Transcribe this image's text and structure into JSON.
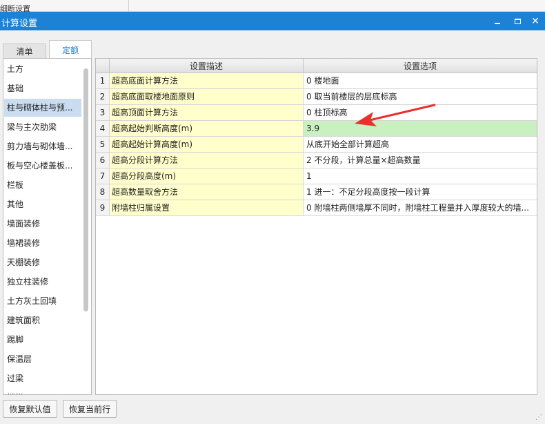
{
  "background_window": {
    "text": "细断设置"
  },
  "window": {
    "title": "计算设置",
    "minimize_label": "",
    "maximize_label": "",
    "close_label": "✕"
  },
  "tabs": [
    {
      "label": "清单",
      "active": false
    },
    {
      "label": "定额",
      "active": true
    }
  ],
  "left_list": [
    {
      "label": "土方"
    },
    {
      "label": "基础"
    },
    {
      "label": "柱与砌体柱与预...",
      "selected": true
    },
    {
      "label": "梁与主次肋梁"
    },
    {
      "label": "剪力墙与砌体墙..."
    },
    {
      "label": "板与空心楼盖板..."
    },
    {
      "label": "栏板"
    },
    {
      "label": "其他"
    },
    {
      "label": "墙面装修"
    },
    {
      "label": "墙裙装修"
    },
    {
      "label": "天棚装修"
    },
    {
      "label": "独立柱装修"
    },
    {
      "label": "土方灰土回填"
    },
    {
      "label": "建筑面积"
    },
    {
      "label": "踢脚"
    },
    {
      "label": "保温层"
    },
    {
      "label": "过梁"
    },
    {
      "label": "楼梯..."
    }
  ],
  "grid": {
    "headers": {
      "description": "设置描述",
      "option": "设置选项"
    },
    "rows": [
      {
        "num": "1",
        "desc": "超高底面计算方法",
        "opt": "0 楼地面"
      },
      {
        "num": "2",
        "desc": "超高底面取楼地面原则",
        "opt": "0 取当前楼层的层底标高"
      },
      {
        "num": "3",
        "desc": "超高顶面计算方法",
        "opt": "0 柱顶标高"
      },
      {
        "num": "4",
        "desc": "超高起始判断高度(m)",
        "opt": "3.9",
        "highlight": true
      },
      {
        "num": "5",
        "desc": "超高起始计算高度(m)",
        "opt": "从底开始全部计算超高"
      },
      {
        "num": "6",
        "desc": "超高分段计算方法",
        "opt": "2 不分段，计算总量×超高数量"
      },
      {
        "num": "7",
        "desc": "超高分段高度(m)",
        "opt": "1"
      },
      {
        "num": "8",
        "desc": "超高数量取舍方法",
        "opt": "1 进一：不足分段高度按一段计算"
      },
      {
        "num": "9",
        "desc": "附墙柱归属设置",
        "opt": "0 附墙柱两侧墙厚不同时，附墙柱工程量并入厚度较大的墙..."
      }
    ]
  },
  "buttons": {
    "restore_default": "恢复默认值",
    "restore_current": "恢复当前行"
  },
  "colors": {
    "titlebar": "#1d82d4",
    "description_bg": "#ffffcc",
    "highlight_row": "#c8f0c0",
    "selected_item": "#c9dcf0",
    "annotation_arrow": "#e8302c"
  }
}
